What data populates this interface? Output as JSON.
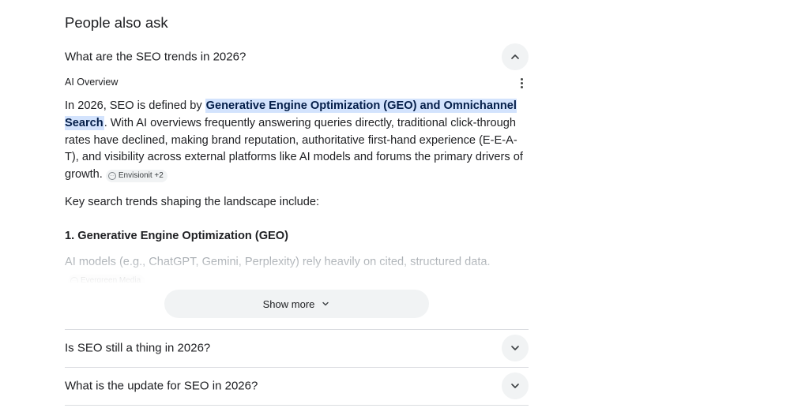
{
  "paa": {
    "title": "People also ask",
    "questions": [
      {
        "text": "What are the SEO trends in 2026?",
        "expanded": true
      },
      {
        "text": "Is SEO still a thing in 2026?",
        "expanded": false
      },
      {
        "text": "What is the update for SEO in 2026?",
        "expanded": false
      }
    ]
  },
  "ai_overview": {
    "label": "AI Overview",
    "intro_prefix": "In 2026, SEO is defined by ",
    "highlight": "Generative Engine Optimization (GEO) and Omnichannel Search",
    "intro_suffix": ". With AI overviews frequently answering queries directly, traditional click-through rates have declined, making brand reputation, authoritative first-hand experience (E-E-A-T), and visibility across external platforms like AI models and forums the primary drivers of growth.",
    "intro_source": "Envisionit +2",
    "key_trends": "Key search trends shaping the landscape include:",
    "geo_heading": "1. Generative Engine Optimization (GEO)",
    "geo_text": "AI models (e.g., ChatGPT, Gemini, Perplexity) rely heavily on cited, structured data.",
    "geo_source": "Evergreen Media",
    "show_more": "Show more"
  },
  "icons": {
    "expand": "chevron-up-icon",
    "collapse": "chevron-down-icon",
    "menu": "more-vert-icon",
    "source": "source-link-icon"
  },
  "colors": {
    "highlight_bg": "#d3e3fd",
    "highlight_text": "#041e49",
    "chip_bg": "#f1f3f4",
    "divider": "#dadce0"
  }
}
